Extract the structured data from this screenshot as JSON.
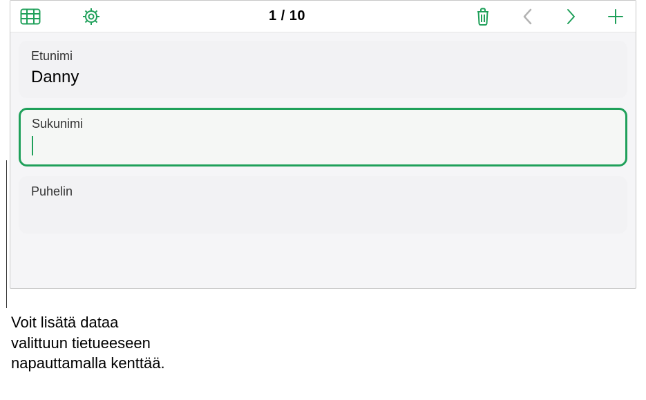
{
  "toolbar": {
    "record_counter": "1 / 10"
  },
  "fields": [
    {
      "label": "Etunimi",
      "value": "Danny",
      "selected": false
    },
    {
      "label": "Sukunimi",
      "value": "",
      "selected": true
    },
    {
      "label": "Puhelin",
      "value": "",
      "selected": false
    }
  ],
  "callout": {
    "line1": "Voit lisätä dataa",
    "line2": "valittuun tietueeseen",
    "line3": "napauttamalla kenttää."
  },
  "colors": {
    "accent": "#1fa05a"
  }
}
